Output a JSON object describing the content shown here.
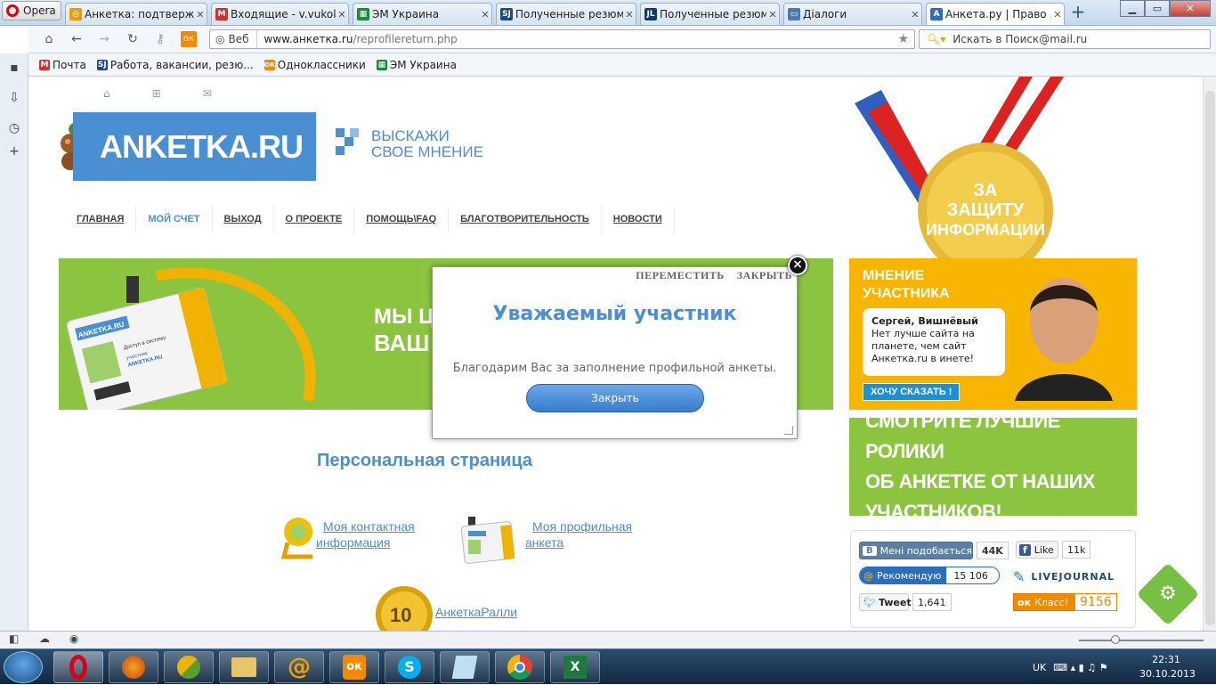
{
  "browser": {
    "menu_label": "Opera",
    "tabs": [
      {
        "title": "Анкетка: подтвержд...",
        "fav": "◎",
        "fav_color": "#e8a000"
      },
      {
        "title": "Входящие - v.vukol...",
        "fav": "M",
        "fav_color": "#c33"
      },
      {
        "title": "ЭМ Украина",
        "fav": "▦",
        "fav_color": "#1d8a3a"
      },
      {
        "title": "Полученные резюме",
        "fav": "SJ",
        "fav_color": "#1a4a8a"
      },
      {
        "title": "Полученные резюме",
        "fav": "JL",
        "fav_color": "#123a6b"
      },
      {
        "title": "Діалоги",
        "fav": "▭",
        "fav_color": "#4a7ab0"
      },
      {
        "title": "Анкета.ру | Право ...",
        "fav": "А",
        "fav_color": "#2a6ebd"
      }
    ],
    "new_tab": "+",
    "address": {
      "prefix": "Веб",
      "host": "www.анкетка.ru",
      "path": "/reprofilereturn.php"
    },
    "search_placeholder": "Искать в Поиск@mail.ru",
    "bookmarks": [
      {
        "label": "Почта",
        "icon": "M",
        "color": "#c33"
      },
      {
        "label": "Работа, вакансии, резю...",
        "icon": "SJ",
        "color": "#1a4a8a"
      },
      {
        "label": "Одноклассники",
        "icon": "ок",
        "color": "#f28a00"
      },
      {
        "label": "ЭМ Украина",
        "icon": "▦",
        "color": "#1d8a3a"
      }
    ]
  },
  "site": {
    "logo": "АNKETKA.RU",
    "slogan_line1": "ВЫСКАЖИ",
    "slogan_line2": "СВОЕ МНЕНИЕ",
    "menu": [
      "ГЛАВНАЯ",
      "МОЙ СЧЕТ",
      "ВЫХОД",
      "О ПРОЕКТЕ",
      "ПОМОЩЬ\\FAQ",
      "БЛАГОТВОРИТЕЛЬНОСТЬ",
      "НОВОСТИ"
    ],
    "medal_text_1": "ЗА",
    "medal_text_2": "ЗАЩИТУ",
    "medal_text_3": "ИНФОРМАЦИИ",
    "banner_text_1": "МЫ Ц",
    "banner_text_2": "ВАШ",
    "badge": {
      "logo": "АNKETKA.RU",
      "line1": "Доступ в систему",
      "line2": "участник",
      "line3": "ANKETKA.RU"
    },
    "opinion": {
      "title_1": "МНЕНИЕ",
      "title_2": "УЧАСТНИКА",
      "author": "Сергей, Вишнёвый",
      "quote": "Нет лучше сайта на планете, чем сайт Анкетка.ru в инете!",
      "button": "ХОЧУ СКАЗАТЬ !"
    },
    "videos_line1": "СМОТРИТЕ ЛУЧШИЕ РОЛИКИ",
    "videos_line2": "ОБ АНКЕТКЕ ОТ НАШИХ УЧАСТНИКОВ!",
    "social": {
      "vk_label": "Мені подобається",
      "vk_count": "44K",
      "fb_label": "Like",
      "fb_count": "11k",
      "mail_label": "Рекомендую",
      "mail_count": "15 106",
      "lj_label": "LIVEJOURNAL",
      "tw_label": "Tweet",
      "tw_count": "1,641",
      "ok_label": "Класс!",
      "ok_count": "9156"
    },
    "personal_title": "Персональная страница",
    "links": {
      "contact_1": "Моя контактная",
      "contact_2": "информация",
      "profile_1": "Моя профильная",
      "profile_2": "анкета",
      "rally": "АнкеткаРалли"
    }
  },
  "modal": {
    "move": "ПЕРЕМЕСТИТЬ",
    "close_link": "ЗАКРЫТЬ",
    "title": "Уважаемый участник",
    "message": "Благодарим Вас за заполнение профильной анкеты.",
    "button": "Закрыть"
  },
  "taskbar": {
    "lang": "UK",
    "time": "22:31",
    "date": "30.10.2013"
  }
}
